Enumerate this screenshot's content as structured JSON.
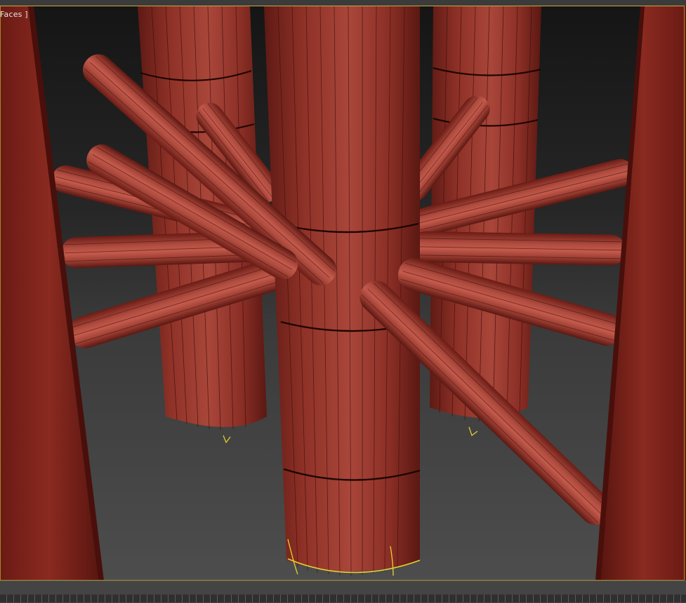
{
  "viewport": {
    "label": "Faces ]",
    "colors": {
      "background_top": "#1c1c1c",
      "background_bottom": "#4a4a4a",
      "object_red": "#9c3a31",
      "object_red_dark": "#5a1712",
      "object_red_light": "#c8574a",
      "edge_line": "#3a0c08",
      "selection_yellow": "#e8d22e",
      "frame_yellow": "#c9a83a"
    },
    "icons": {
      "scene": "3d-viewport-scene"
    }
  }
}
